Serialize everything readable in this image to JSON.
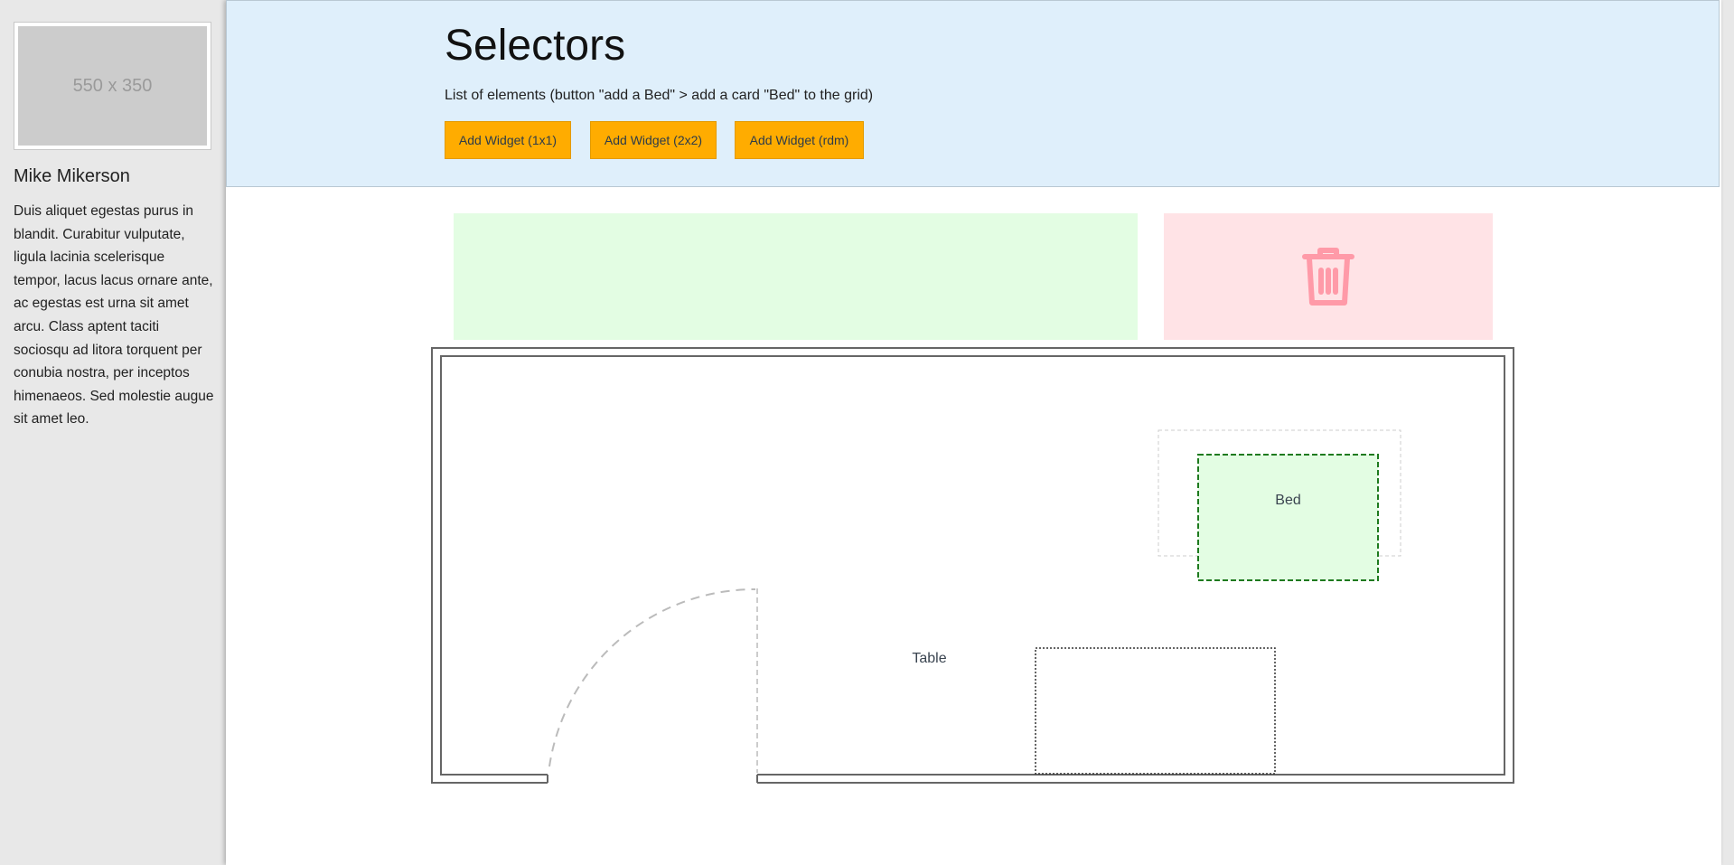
{
  "profile": {
    "avatar_placeholder": "550 x 350",
    "name": "Mike Mikerson",
    "bio": "Duis aliquet egestas purus in blandit. Curabitur vulputate, ligula lacinia scelerisque tempor, lacus lacus ornare ante, ac egestas est urna sit amet arcu. Class aptent taciti sociosqu ad litora torquent per conubia nostra, per inceptos himenaeos. Sed molestie augue sit amet leo."
  },
  "header": {
    "title": "Selectors",
    "subtitle": "List of elements (button \"add a Bed\" > add a card \"Bed\" to the grid)",
    "buttons": [
      {
        "label": "Add Widget (1x1)"
      },
      {
        "label": "Add Widget (2x2)"
      },
      {
        "label": "Add Widget (rdm)"
      }
    ]
  },
  "zones": {
    "drop_zone_color": "#e3fde3",
    "trash_zone_color": "#ffe3e6",
    "trash_icon": "trash-icon",
    "trash_icon_color": "#ff9aa8"
  },
  "floor_plan": {
    "cards": [
      {
        "label": "Bed",
        "color": "#e3fde3",
        "border": "#1e7a1e"
      },
      {
        "label": "Table",
        "color": "#ffffff",
        "border": "#333333"
      }
    ]
  }
}
